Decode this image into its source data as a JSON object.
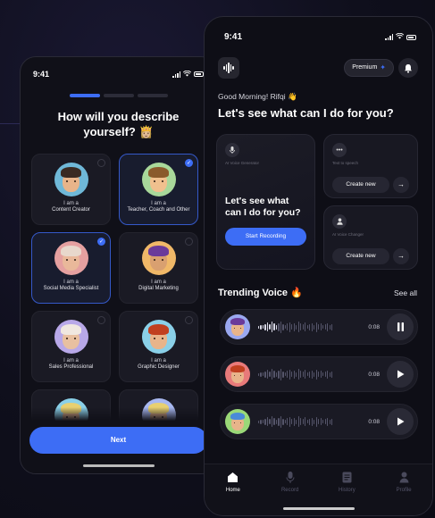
{
  "onboarding": {
    "status_time": "9:41",
    "progress_steps": 3,
    "progress_active": 1,
    "title": "How will you describe yourself? 👸🏼",
    "roles": [
      {
        "prefix": "I am a",
        "name": "Content Creator",
        "selected": false,
        "bg": "#6fb8d8",
        "skin": "#e8b48a",
        "hair": "#3a2a22"
      },
      {
        "prefix": "I am a",
        "name": "Teacher, Coach and Other",
        "selected": true,
        "bg": "#a8d89a",
        "skin": "#f0c08e",
        "hair": "#8a5a2c"
      },
      {
        "prefix": "I am a",
        "name": "Social Media Specialist",
        "selected": true,
        "bg": "#e5a0a0",
        "skin": "#e9b89a",
        "hair": "#e8d8cc"
      },
      {
        "prefix": "I am a",
        "name": "Digital Marketing",
        "selected": false,
        "bg": "#f0b868",
        "skin": "#d9a070",
        "hair": "#6a3a9a"
      },
      {
        "prefix": "I am a",
        "name": "Sales Professional",
        "selected": false,
        "bg": "#b8a8e8",
        "skin": "#e8c0a0",
        "hair": "#f0e8e0"
      },
      {
        "prefix": "I am a",
        "name": "Graphic Designer",
        "selected": false,
        "bg": "#8ad0e8",
        "skin": "#e8b48a",
        "hair": "#c04020"
      }
    ],
    "next_label": "Next"
  },
  "home": {
    "status_time": "9:41",
    "premium_label": "Premium",
    "greeting": "Good Morning! Rifqi 👋",
    "headline": "Let's see what can I do for you?",
    "card_ai_voice": {
      "caption": "AI Voice Generator",
      "title": "Let's see what can I do for you?",
      "button": "Start Recording"
    },
    "card_tts": {
      "caption": "Text to speech",
      "button": "Create new"
    },
    "card_voice_change": {
      "caption": "AI Voice Changer",
      "button": "Create new"
    },
    "trending_title": "Trending Voice 🔥",
    "see_all": "See all",
    "voices": [
      {
        "duration": "0:08",
        "state": "playing",
        "bg": "#9aa8f0",
        "skin": "#e8b48a",
        "hair": "#6a3a9a",
        "played_fraction": 0.25
      },
      {
        "duration": "0:08",
        "state": "paused",
        "bg": "#e87a7a",
        "skin": "#e8b48a",
        "hair": "#c04020",
        "played_fraction": 0
      },
      {
        "duration": "0:08",
        "state": "paused",
        "bg": "#9ad878",
        "skin": "#e8b48a",
        "hair": "#4a8ad8",
        "played_fraction": 0
      }
    ],
    "tabs": [
      {
        "label": "Home",
        "icon": "home-icon",
        "active": true
      },
      {
        "label": "Record",
        "icon": "mic-icon",
        "active": false
      },
      {
        "label": "History",
        "icon": "history-icon",
        "active": false
      },
      {
        "label": "Profile",
        "icon": "profile-icon",
        "active": false
      }
    ]
  },
  "colors": {
    "accent": "#3d6df5",
    "background": "#0e0e16"
  }
}
